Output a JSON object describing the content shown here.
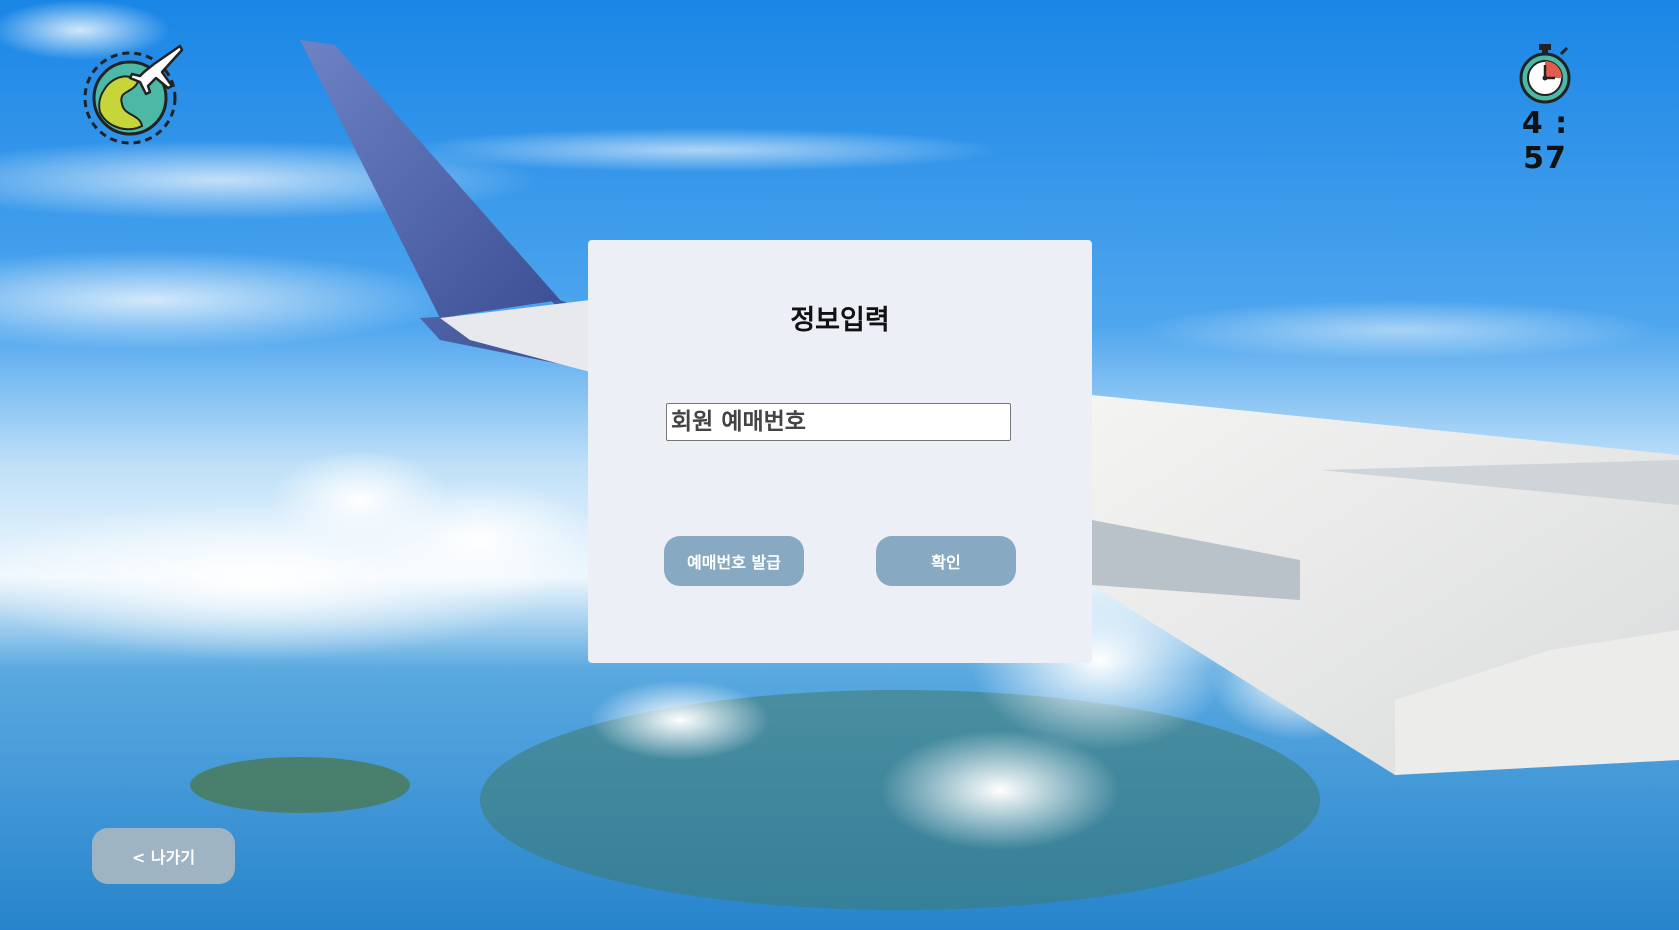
{
  "background": {
    "icon": "airplane-wing-sky-photo"
  },
  "logo": {
    "icon": "globe-airplane-icon"
  },
  "timer": {
    "icon": "stopwatch-icon",
    "remaining": "4 : 57"
  },
  "form": {
    "title": "정보입력",
    "input_placeholder": "회원 예매번호",
    "input_value": "",
    "issue_button_label": "예매번호 발급",
    "confirm_button_label": "확인"
  },
  "nav": {
    "exit_label": "< 나가기"
  },
  "colors": {
    "panel_bg": "#eceff5",
    "button_bg": "#87a9c1",
    "exit_button_bg": "#9eb4c3",
    "sky": "#2f8fe6"
  }
}
